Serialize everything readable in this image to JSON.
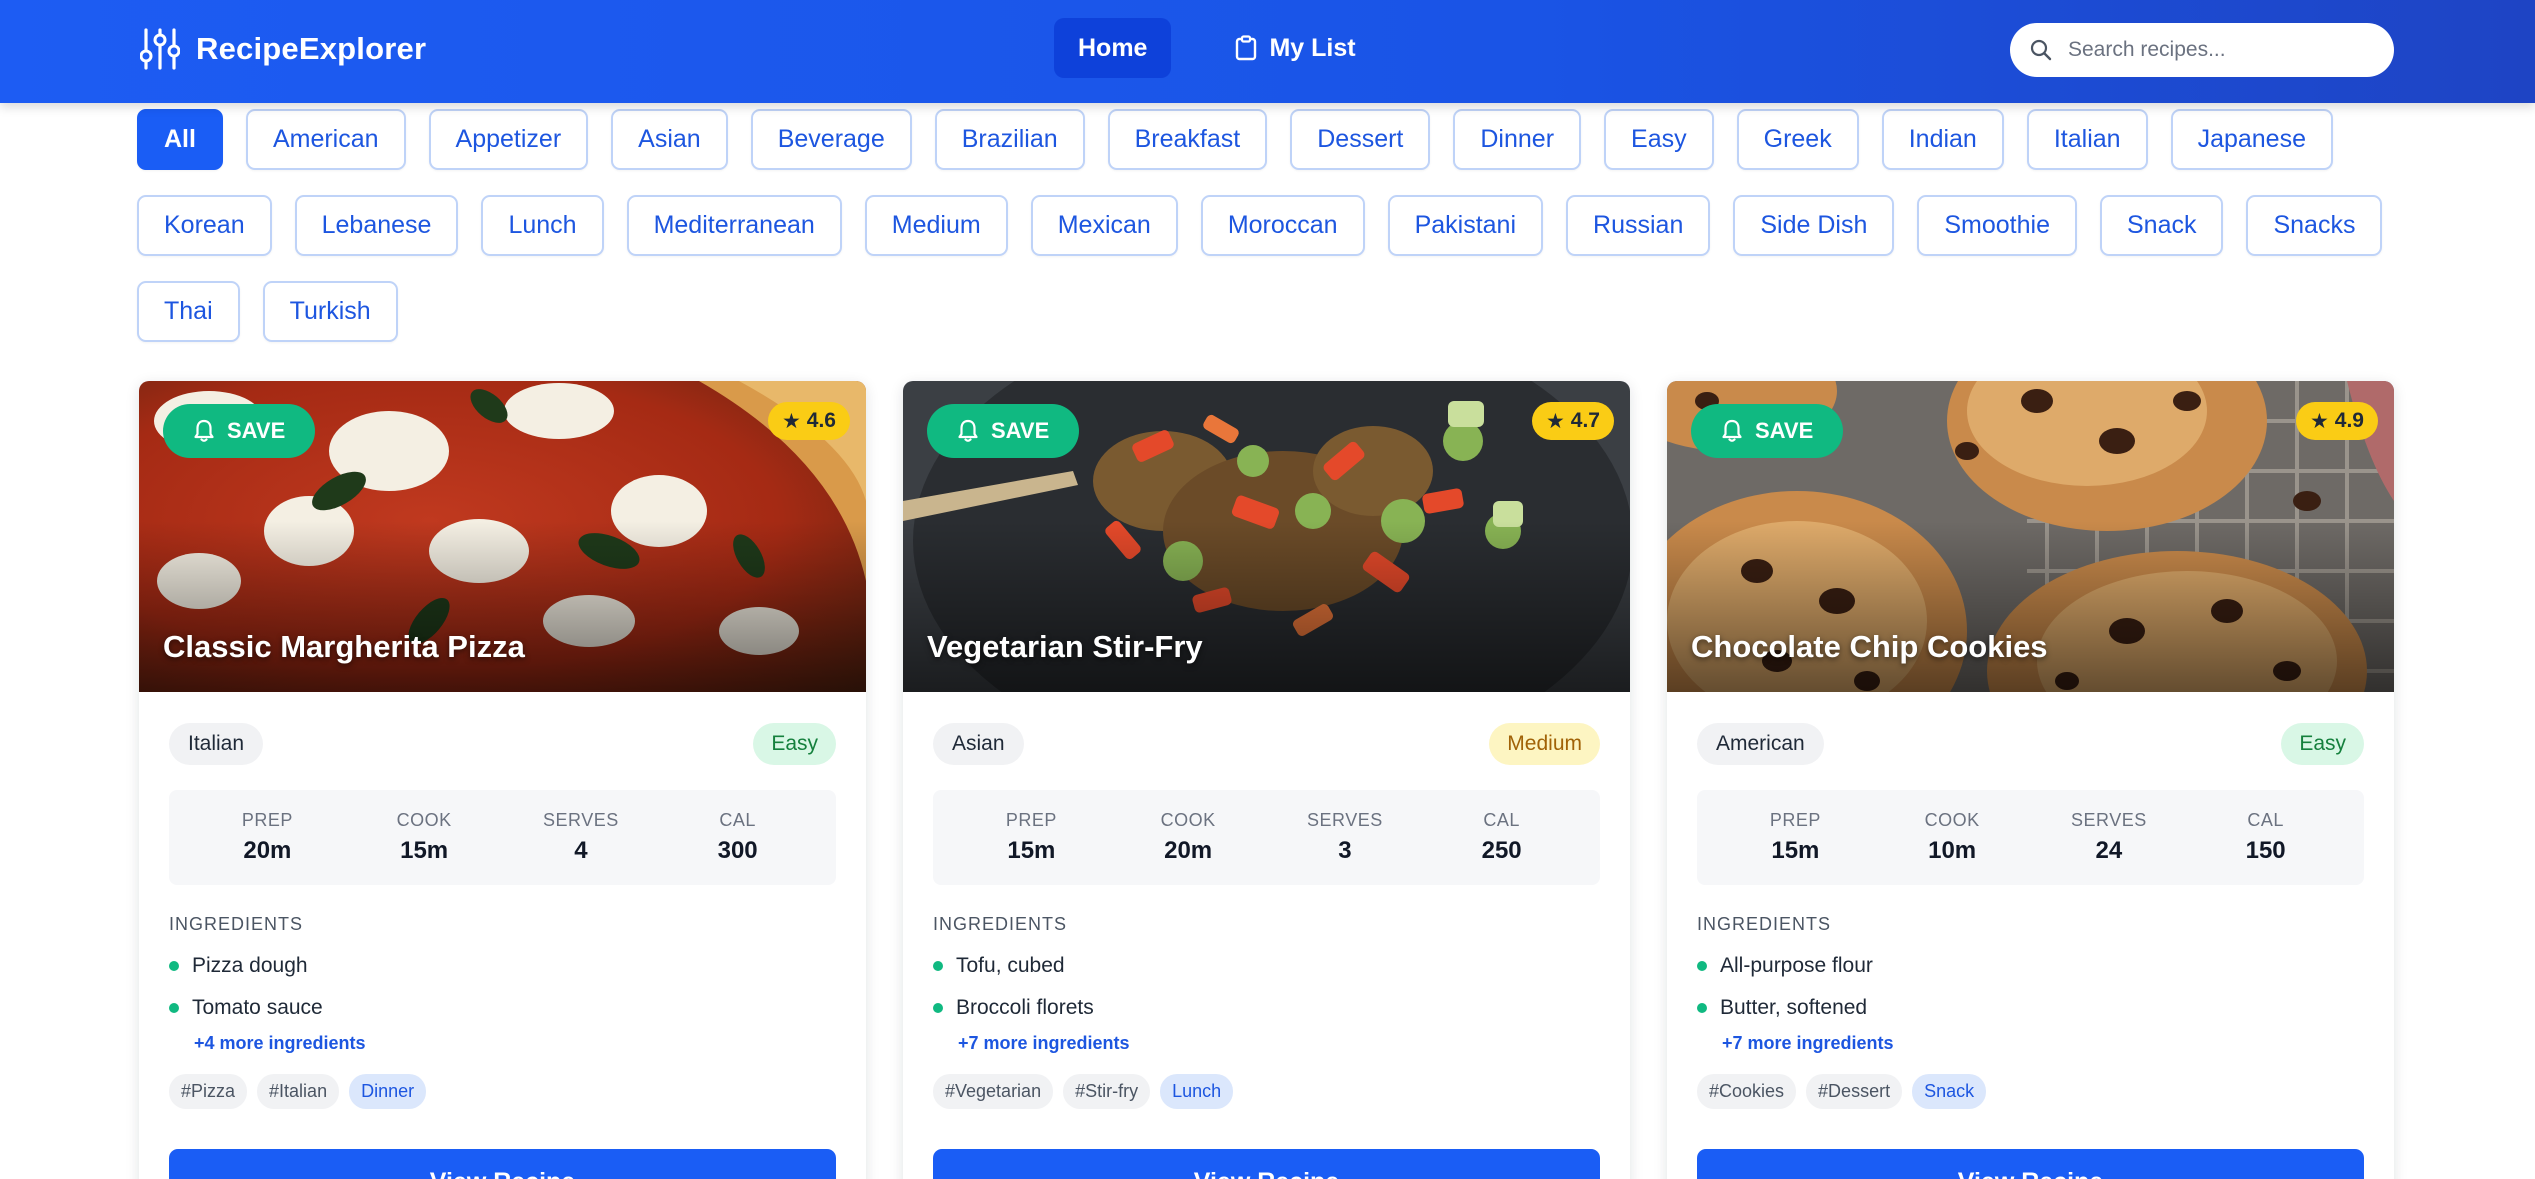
{
  "app": {
    "name": "RecipeExplorer"
  },
  "nav": [
    {
      "label": "Home",
      "active": true
    },
    {
      "label": "My List",
      "active": false
    }
  ],
  "search": {
    "placeholder": "Search recipes..."
  },
  "filters": [
    "All",
    "American",
    "Appetizer",
    "Asian",
    "Beverage",
    "Brazilian",
    "Breakfast",
    "Dessert",
    "Dinner",
    "Easy",
    "Greek",
    "Indian",
    "Italian",
    "Japanese",
    "Korean",
    "Lebanese",
    "Lunch",
    "Mediterranean",
    "Medium",
    "Mexican",
    "Moroccan",
    "Pakistani",
    "Russian",
    "Side Dish",
    "Smoothie",
    "Snack",
    "Snacks",
    "Thai",
    "Turkish"
  ],
  "active_filter": "All",
  "labels": {
    "save": "SAVE",
    "star": "★",
    "prep": "PREP",
    "cook": "COOK",
    "serves": "SERVES",
    "cal": "CAL",
    "ingredients": "INGREDIENTS",
    "view_recipe": "View Recipe"
  },
  "recipes": [
    {
      "title": "Classic Margherita Pizza",
      "rating": "4.6",
      "cuisine": "Italian",
      "difficulty": "Easy",
      "prep": "20m",
      "cook": "15m",
      "serves": "4",
      "cal": "300",
      "ingredients": [
        "Pizza dough",
        "Tomato sauce"
      ],
      "more": "+4 more ingredients",
      "tags": [
        "#Pizza",
        "#Italian"
      ],
      "meal": "Dinner",
      "image": "pizza"
    },
    {
      "title": "Vegetarian Stir-Fry",
      "rating": "4.7",
      "cuisine": "Asian",
      "difficulty": "Medium",
      "prep": "15m",
      "cook": "20m",
      "serves": "3",
      "cal": "250",
      "ingredients": [
        "Tofu, cubed",
        "Broccoli florets"
      ],
      "more": "+7 more ingredients",
      "tags": [
        "#Vegetarian",
        "#Stir-fry"
      ],
      "meal": "Lunch",
      "image": "stir-fry"
    },
    {
      "title": "Chocolate Chip Cookies",
      "rating": "4.9",
      "cuisine": "American",
      "difficulty": "Easy",
      "prep": "15m",
      "cook": "10m",
      "serves": "24",
      "cal": "150",
      "ingredients": [
        "All-purpose flour",
        "Butter, softened"
      ],
      "more": "+7 more ingredients",
      "tags": [
        "#Cookies",
        "#Dessert"
      ],
      "meal": "Snack",
      "image": "cookies"
    }
  ],
  "colors": {
    "header": "#1d5cf3",
    "primary": "#1a5df5",
    "save": "#10b981",
    "rating": "#facc15"
  }
}
